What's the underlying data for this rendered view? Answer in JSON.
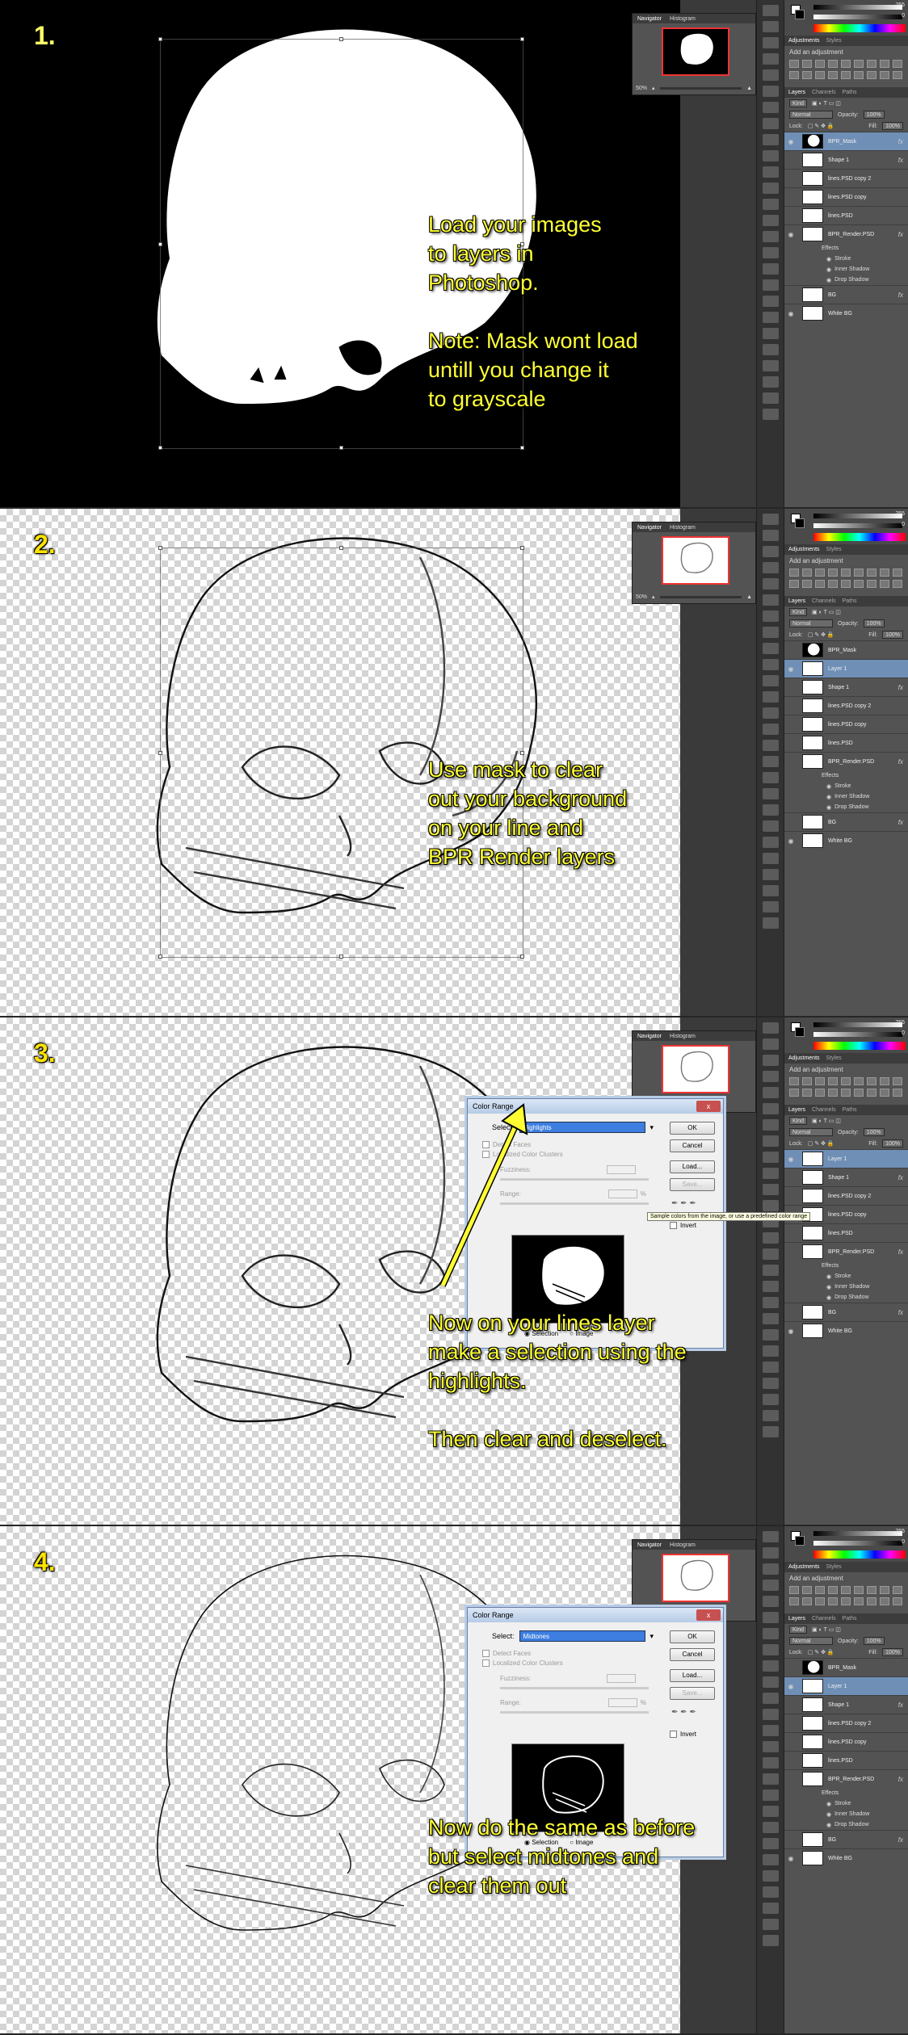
{
  "steps": [
    {
      "number": "1.",
      "callout": "Load your images\nto layers in\nPhotoshop.\n\nNote: Mask wont load\nuntill you change it\nto grayscale",
      "navigator_zoom": "50%",
      "layers": [
        {
          "name": "BPR_Mask",
          "thumb": "mask",
          "selected": true,
          "eye": true,
          "fx": true
        },
        {
          "name": "Shape 1",
          "thumb": "white",
          "selected": false,
          "eye": false,
          "fx": true
        },
        {
          "name": "lines.PSD copy 2",
          "thumb": "white",
          "selected": false,
          "eye": false,
          "fx": false
        },
        {
          "name": "lines.PSD copy",
          "thumb": "white",
          "selected": false,
          "eye": false,
          "fx": false
        },
        {
          "name": "lines.PSD",
          "thumb": "white",
          "selected": false,
          "eye": false,
          "fx": false
        },
        {
          "name": "BPR_Render.PSD",
          "thumb": "white",
          "selected": false,
          "eye": true,
          "fx": true
        }
      ],
      "effects": [
        "Stroke",
        "Inner Shadow",
        "Drop Shadow"
      ],
      "bottom_layers": [
        {
          "name": "BG",
          "thumb": "white",
          "fx": true
        },
        {
          "name": "White BG",
          "thumb": "white",
          "fx": false
        }
      ]
    },
    {
      "number": "2.",
      "callout": "Use mask to clear\nout your background\non your line and\nBPR Render layers",
      "navigator_zoom": "50%",
      "layers": [
        {
          "name": "BPR_Mask",
          "thumb": "mask",
          "selected": false,
          "eye": false,
          "fx": false
        },
        {
          "name": "Layer 1",
          "thumb": "white",
          "selected": true,
          "eye": true,
          "fx": false
        },
        {
          "name": "Shape 1",
          "thumb": "white",
          "selected": false,
          "eye": false,
          "fx": true
        },
        {
          "name": "lines.PSD copy 2",
          "thumb": "white",
          "selected": false,
          "eye": false,
          "fx": false
        },
        {
          "name": "lines.PSD copy",
          "thumb": "white",
          "selected": false,
          "eye": false,
          "fx": false
        },
        {
          "name": "lines.PSD",
          "thumb": "white",
          "selected": false,
          "eye": false,
          "fx": false
        },
        {
          "name": "BPR_Render.PSD",
          "thumb": "white",
          "selected": false,
          "eye": false,
          "fx": true
        }
      ],
      "effects": [
        "Stroke",
        "Inner Shadow",
        "Drop Shadow"
      ],
      "bottom_layers": [
        {
          "name": "BG",
          "thumb": "white",
          "fx": true
        },
        {
          "name": "White BG",
          "thumb": "white",
          "fx": false
        }
      ]
    },
    {
      "number": "3.",
      "callout": "Now on your lines layer\nmake a selection using the\nhighlights.\n\nThen clear and deselect.",
      "select_value": "Highlights",
      "layers": [
        {
          "name": "Layer 1",
          "thumb": "white",
          "selected": true,
          "eye": true,
          "fx": false
        },
        {
          "name": "Shape 1",
          "thumb": "white",
          "selected": false,
          "eye": false,
          "fx": true
        },
        {
          "name": "lines.PSD copy 2",
          "thumb": "white",
          "selected": false,
          "eye": false,
          "fx": false
        },
        {
          "name": "lines.PSD copy",
          "thumb": "white",
          "selected": false,
          "eye": false,
          "fx": false
        },
        {
          "name": "lines.PSD",
          "thumb": "white",
          "selected": false,
          "eye": false,
          "fx": false
        },
        {
          "name": "BPR_Render.PSD",
          "thumb": "white",
          "selected": false,
          "eye": false,
          "fx": true
        }
      ],
      "effects": [
        "Stroke",
        "Inner Shadow",
        "Drop Shadow"
      ],
      "bottom_layers": [
        {
          "name": "BG",
          "thumb": "white",
          "fx": true
        },
        {
          "name": "White BG",
          "thumb": "white",
          "fx": false
        }
      ]
    },
    {
      "number": "4.",
      "callout": "Now do the same as before\nbut select midtones and\nclear them out",
      "select_value": "Midtones",
      "layers": [
        {
          "name": "BPR_Mask",
          "thumb": "mask",
          "selected": false,
          "eye": false,
          "fx": false
        },
        {
          "name": "Layer 1",
          "thumb": "white",
          "selected": true,
          "eye": true,
          "fx": false
        },
        {
          "name": "Shape 1",
          "thumb": "white",
          "selected": false,
          "eye": false,
          "fx": true
        },
        {
          "name": "lines.PSD copy 2",
          "thumb": "white",
          "selected": false,
          "eye": false,
          "fx": false
        },
        {
          "name": "lines.PSD copy",
          "thumb": "white",
          "selected": false,
          "eye": false,
          "fx": false
        },
        {
          "name": "lines.PSD",
          "thumb": "white",
          "selected": false,
          "eye": false,
          "fx": false
        },
        {
          "name": "BPR_Render.PSD",
          "thumb": "white",
          "selected": false,
          "eye": false,
          "fx": true
        }
      ],
      "effects": [
        "Stroke",
        "Inner Shadow",
        "Drop Shadow"
      ],
      "bottom_layers": [
        {
          "name": "BG",
          "thumb": "white",
          "fx": true
        },
        {
          "name": "White BG",
          "thumb": "white",
          "fx": false
        }
      ]
    }
  ],
  "panels": {
    "navigator_tab": "Navigator",
    "histogram_tab": "Histogram",
    "adjustments_tab": "Adjustments",
    "styles_tab": "Styles",
    "add_adjustment": "Add an adjustment",
    "layers_tab": "Layers",
    "channels_tab": "Channels",
    "paths_tab": "Paths",
    "kind_label": "Kind",
    "blend_mode": "Normal",
    "opacity_label": "Opacity:",
    "opacity_value": "100%",
    "lock_label": "Lock:",
    "fill_label": "Fill:",
    "fill_value": "100%",
    "effects_label": "Effects",
    "color_value_top": "255",
    "color_value_bottom": "0"
  },
  "color_range": {
    "title": "Color Range",
    "select_label": "Select:",
    "detect_faces": "Detect Faces",
    "localized_clusters": "Localized Color Clusters",
    "fuzziness_label": "Fuzziness:",
    "range_label": "Range:",
    "percent": "%",
    "ok": "OK",
    "cancel": "Cancel",
    "load": "Load...",
    "save": "Save...",
    "invert": "Invert",
    "selection": "Selection",
    "image": "Image",
    "tooltip": "Sample colors from the image, or use a predefined color range",
    "close": "x"
  }
}
